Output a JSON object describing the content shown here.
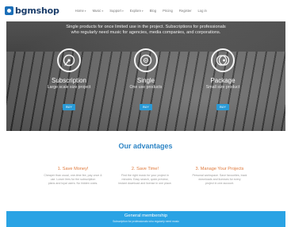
{
  "brand": {
    "name": "bgmshop"
  },
  "nav": [
    {
      "label": "Home",
      "caret": "▾"
    },
    {
      "label": "Music",
      "caret": "▾"
    },
    {
      "label": "Support",
      "caret": "▾"
    },
    {
      "label": "Explore",
      "caret": "▾"
    },
    {
      "label": "Blog",
      "caret": ""
    },
    {
      "label": "Pricing",
      "caret": ""
    },
    {
      "label": "Register",
      "caret": ""
    },
    {
      "label": "Log in",
      "caret": ""
    }
  ],
  "hero": {
    "headline_line1": "Single products for once limited use in the project. Subscriptions for professionals",
    "headline_line2": "who regularly need music for agencies, media companies, and corporations.",
    "plans": [
      {
        "title": "Subscription",
        "subtitle": "Large scale size project",
        "buy": "BUY",
        "icon": "vinyl-record-icon"
      },
      {
        "title": "Single",
        "subtitle": "One use products",
        "buy": "BUY",
        "icon": "music-disc-icon"
      },
      {
        "title": "Package",
        "subtitle": "Small size product",
        "buy": "BUY",
        "icon": "disc-stack-icon"
      }
    ]
  },
  "advantages": {
    "title": "Our advantages",
    "items": [
      {
        "heading": "1. Save Money!",
        "text_line1": "Cheaper than usual, one-time fee, pay once &",
        "text_line2": "use. Lower fees for the subscription",
        "text_line3": "plans and loyal users. No hidden costs."
      },
      {
        "heading": "2. Save Time!",
        "text_line1": "Find the right music for your project in",
        "text_line2": "minutes. Easy search, quick preview,",
        "text_line3": "instant download and license in one place."
      },
      {
        "heading": "3. Manage Your Projects",
        "text_line1": "Personal workspace. Save favourites, track",
        "text_line2": "downloads and licenses for every",
        "text_line3": "project in one account."
      }
    ]
  },
  "membership": {
    "title": "General membership",
    "subtitle": "Subscription for professionals who regularly need music"
  },
  "colors": {
    "brand": "#1c3e6b",
    "accent": "#2a9ad6",
    "title": "#2f86c6",
    "orange": "#e07a3c"
  }
}
